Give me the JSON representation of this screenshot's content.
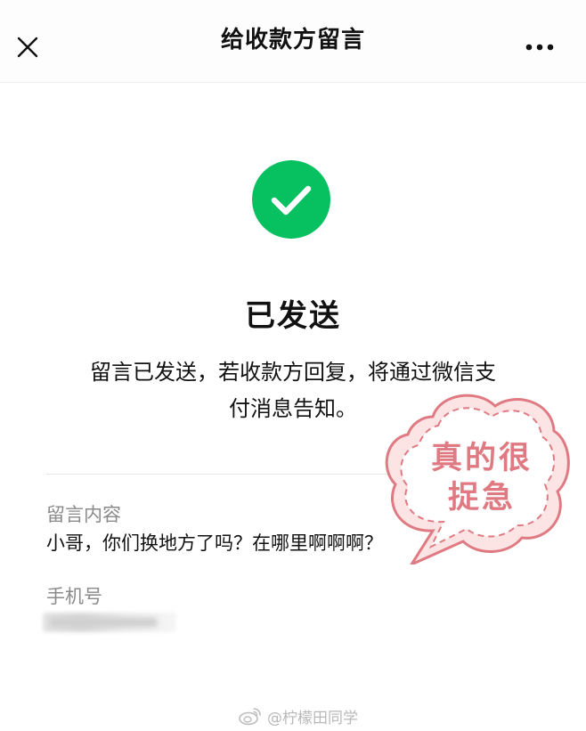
{
  "header": {
    "title": "给收款方留言",
    "close_icon": "close-icon",
    "more_icon": "more-horizontal-icon"
  },
  "status": {
    "icon": "check-circle-icon",
    "title": "已发送",
    "description_line1": "留言已发送，若收款方回复，将通过微信支",
    "description_line2": "付消息告知。"
  },
  "details": {
    "message_label": "留言内容",
    "message_value": "小哥，你们换地方了吗？在哪里啊啊啊？",
    "phone_label": "手机号"
  },
  "sticker": {
    "line1": "真的很",
    "line2": "捉急"
  },
  "watermark": {
    "icon": "weibo-icon",
    "text": "@柠檬田同学"
  },
  "colors": {
    "success_green": "#07c160",
    "sticker_pink": "#e07a82",
    "label_gray": "#8a8a8a"
  }
}
